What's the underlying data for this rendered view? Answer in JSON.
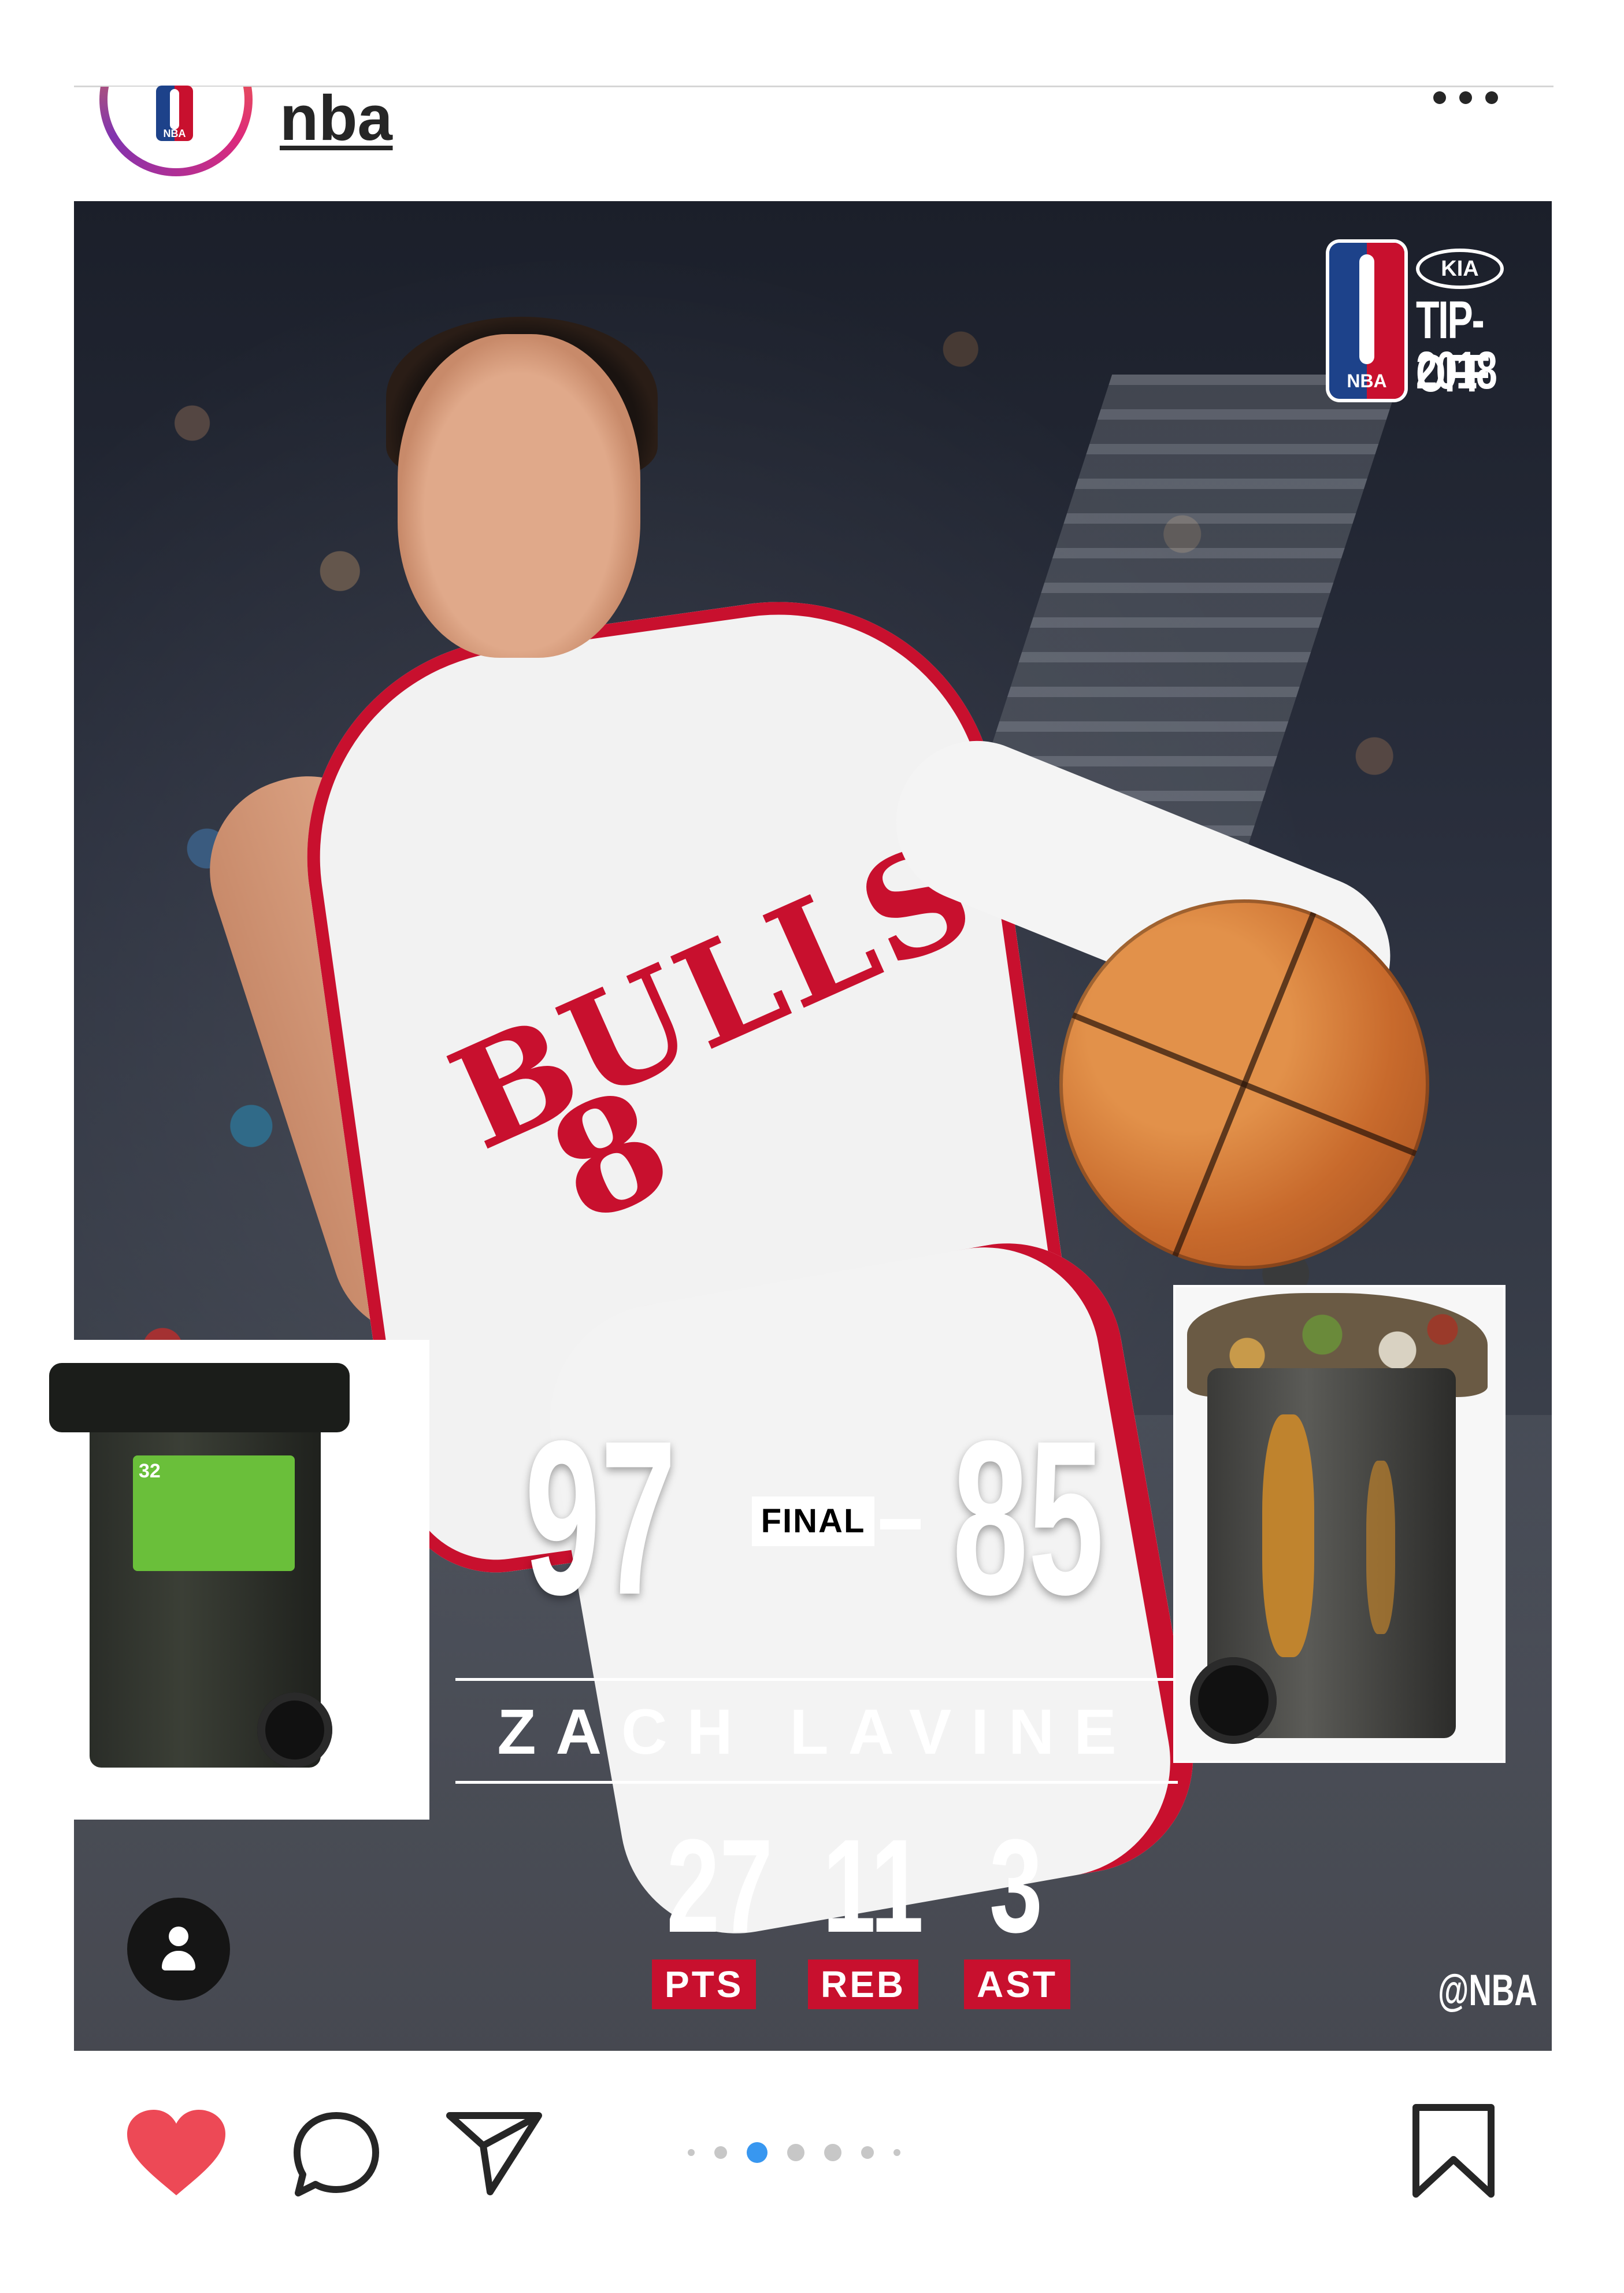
{
  "header": {
    "username": "nba",
    "avatar_logo_text": "NBA",
    "more_icon": "more-horizontal-icon"
  },
  "post": {
    "badge": {
      "logo_text": "NBA",
      "sponsor": "KIA",
      "title_line1": "TIP-OFF",
      "title_line2": "2018"
    },
    "jersey": {
      "team": "BULLS",
      "number": "8"
    },
    "scoreboard": {
      "left_score": "97",
      "status": "FINAL",
      "right_score": "85",
      "player_name": "ZACH LAVINE",
      "stats": [
        {
          "value": "27",
          "label": "PTS"
        },
        {
          "value": "11",
          "label": "REB"
        },
        {
          "value": "3",
          "label": "AST"
        }
      ],
      "handle": "@NBA"
    },
    "overlay_left": {
      "label_size": "32"
    },
    "tag_icon": "user-tag-icon"
  },
  "actions": {
    "like_icon": "heart-icon",
    "comment_icon": "comment-icon",
    "share_icon": "send-icon",
    "save_icon": "bookmark-icon",
    "carousel": {
      "count": 7,
      "active_index": 2
    },
    "colors": {
      "like": "#ed4956",
      "carousel_active": "#3897f0",
      "carousel_inactive": "#c7c7c7"
    }
  }
}
